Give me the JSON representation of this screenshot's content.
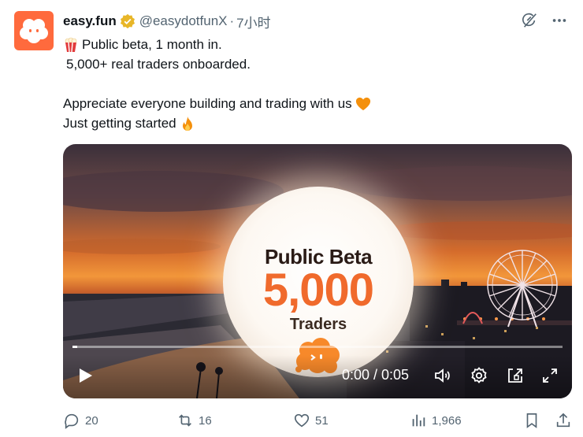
{
  "author": {
    "name": "easy.fun",
    "handle": "@easydotfunX",
    "separator": "·",
    "time": "7小时"
  },
  "tweet": {
    "lines": [
      "Public beta, 1 month in.",
      "5,000+ real traders onboarded.",
      "Appreciate everyone building and trading with us",
      "Just getting started"
    ],
    "emojis": [
      "popcorn-emoji",
      "orange-heart-emoji",
      "fire-emoji"
    ]
  },
  "media": {
    "orb_title": "Public Beta",
    "orb_number": "5,000",
    "orb_subtitle": "Traders",
    "video_time": "0:00 / 0:05",
    "progress": 0.01
  },
  "actions": {
    "replies": "20",
    "reposts": "16",
    "likes": "51",
    "views": "1,966"
  },
  "colors": {
    "brand": "#ff6a3d",
    "verified": "#e8b628",
    "text": "#0f1419",
    "muted": "#536471"
  },
  "icons": [
    "grok-icon",
    "more-icon",
    "play-icon",
    "volume-icon",
    "settings-icon",
    "pip-icon",
    "fullscreen-icon",
    "reply-icon",
    "repost-icon",
    "like-icon",
    "views-icon",
    "bookmark-icon",
    "share-icon"
  ]
}
